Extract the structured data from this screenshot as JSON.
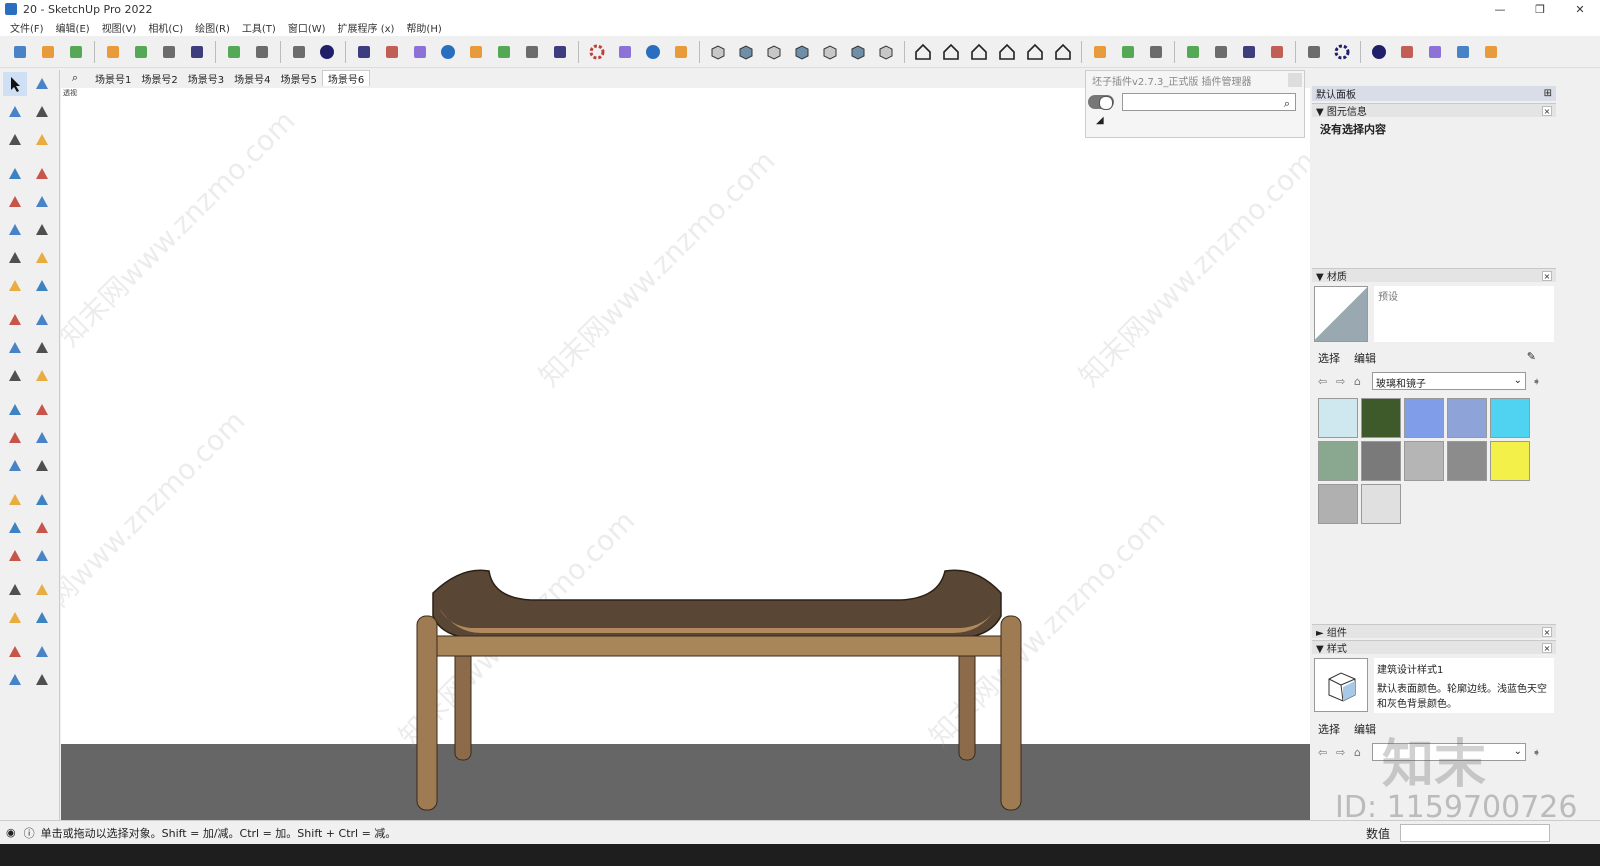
{
  "window": {
    "title": "20 - SketchUp Pro 2022",
    "minimize": "—",
    "restore": "❐",
    "close": "✕"
  },
  "menu": [
    "文件(F)",
    "编辑(E)",
    "视图(V)",
    "相机(C)",
    "绘图(R)",
    "工具(T)",
    "窗口(W)",
    "扩展程序 (x)",
    "帮助(H)"
  ],
  "toolbar": {
    "groups": [
      [
        "new-icon",
        "open-icon",
        "save-icon"
      ],
      [
        "cut-icon",
        "copy-icon",
        "paste-icon",
        "erase-icon"
      ],
      [
        "undo-icon",
        "redo-icon"
      ],
      [
        "print-icon",
        "model-info-icon"
      ],
      [
        "plugin-orange-icon",
        "refresh-icon",
        "transfer-icon",
        "add-circle-icon",
        "tree-icon",
        "sunset-icon",
        "checker-icon",
        "cloud-upload-icon"
      ],
      [
        "settings-gears-icon",
        "mail-icon",
        "info-icon",
        "user-icon"
      ],
      [
        "box-solid-icon",
        "box-outline-icon",
        "box-wire-icon",
        "box-flat-icon",
        "box-shade-icon",
        "box-layers-icon",
        "box-blue-icon"
      ],
      [
        "house-iso-icon",
        "house-front-icon",
        "house-top-icon",
        "house-side-icon",
        "house-outline-icon",
        "house-back-icon"
      ],
      [
        "grid-icon",
        "env-icon",
        "model-icon"
      ],
      [
        "plugin-purple-icon",
        "camera-orbit-icon",
        "camera-position-icon",
        "camera-photo-icon"
      ],
      [
        "geo-location-icon",
        "gear-outline-icon"
      ],
      [
        "dot-icon",
        "cone-icon",
        "line-icon",
        "square-icon",
        "hidden-icon"
      ]
    ]
  },
  "left_tools": [
    [
      "select-arrow-icon",
      "orbit-icon"
    ],
    [
      "paint-bucket-icon",
      "eraser-icon"
    ],
    [
      "component-icon",
      "tag-icon"
    ],
    [
      "gap"
    ],
    [
      "pencil-line-icon",
      "freehand-icon"
    ],
    [
      "rectangle-icon",
      "rotated-rectangle-icon"
    ],
    [
      "circle-icon",
      "polygon-icon"
    ],
    [
      "arc-icon",
      "arc-2point-icon"
    ],
    [
      "arc-3point-icon",
      "pie-icon"
    ],
    [
      "gap"
    ],
    [
      "move-icon",
      "push-pull-icon"
    ],
    [
      "rotate-icon",
      "follow-me-icon"
    ],
    [
      "scale-icon",
      "offset-icon"
    ],
    [
      "gap"
    ],
    [
      "tape-measure-icon",
      "dimension-icon"
    ],
    [
      "protractor-icon",
      "text-label-icon"
    ],
    [
      "axes-icon",
      "3d-text-icon"
    ],
    [
      "gap"
    ],
    [
      "orbit-camera-icon",
      "pan-hand-icon"
    ],
    [
      "zoom-icon",
      "zoom-window-icon"
    ],
    [
      "zoom-extents-icon",
      "previous-view-icon"
    ],
    [
      "gap"
    ],
    [
      "position-camera-icon",
      "look-around-icon"
    ],
    [
      "walk-icon",
      "section-plane-icon"
    ],
    [
      "gap"
    ],
    [
      "sandbox-contour-icon",
      "sandbox-scratch-icon"
    ],
    [
      "sandbox-smoove-icon",
      "sandbox-stamp-icon"
    ]
  ],
  "scenes": {
    "tabs": [
      "场景号1",
      "场景号2",
      "场景号3",
      "场景号4",
      "场景号5",
      "场景号6"
    ],
    "active": 5,
    "viewport_label": "透视"
  },
  "plugin": {
    "title": "坯子插件v2.7.3_正式版 插件管理器",
    "search_placeholder": ""
  },
  "tray": {
    "title": "默认面板",
    "entity_info": {
      "title": "图元信息",
      "text": "没有选择内容"
    },
    "materials": {
      "title": "材质",
      "name_placeholder": "预设",
      "tab_select": "选择",
      "tab_edit": "编辑",
      "collection": "玻璃和镜子",
      "swatches": [
        {
          "name": "swatch-light-blue-grid",
          "color": "#cfe8f0"
        },
        {
          "name": "swatch-green",
          "color": "#3e5a2a"
        },
        {
          "name": "swatch-blue",
          "color": "#7f9de8"
        },
        {
          "name": "swatch-sky",
          "color": "#8ea4d8"
        },
        {
          "name": "swatch-cyan",
          "color": "#4fd3f0"
        },
        {
          "name": "swatch-green-stripe",
          "color": "#8aa890"
        },
        {
          "name": "swatch-grey-tiles",
          "color": "#7a7a7a"
        },
        {
          "name": "swatch-speckle",
          "color": "#b5b5b5"
        },
        {
          "name": "swatch-dark-grey",
          "color": "#8c8c8c"
        },
        {
          "name": "swatch-yellow",
          "color": "#f4f04a"
        },
        {
          "name": "swatch-silver",
          "color": "#b0b0b0"
        },
        {
          "name": "swatch-white-silver",
          "color": "#e0e0e0"
        }
      ]
    },
    "components": {
      "title": "组件"
    },
    "styles": {
      "title": "样式",
      "name": "建筑设计样式1",
      "description": "默认表面颜色。轮廓边线。浅蓝色天空和灰色背景颜色。",
      "tab_select": "选择",
      "tab_edit": "编辑"
    }
  },
  "status": {
    "text": "单击或拖动以选择对象。Shift = 加/减。Ctrl = 加。Shift + Ctrl = 减。",
    "measure_label": "数值"
  },
  "watermark": {
    "id": "ID: 1159700726",
    "logo": "知末"
  }
}
